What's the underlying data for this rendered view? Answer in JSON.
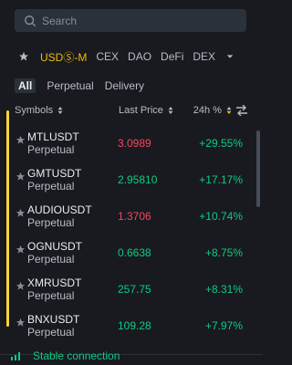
{
  "search": {
    "placeholder": "Search"
  },
  "categories": {
    "items": [
      "USDⓈ-M",
      "CEX",
      "DAO",
      "DeFi",
      "DEX"
    ],
    "active_index": 0
  },
  "subtabs": [
    "All",
    "Perpetual",
    "Delivery"
  ],
  "columns": {
    "symbol": "Symbols",
    "price": "Last Price",
    "change": "24h %"
  },
  "rows": [
    {
      "symbol": "MTLUSDT",
      "type": "Perpetual",
      "price": "3.0989",
      "change": "+29.55%",
      "price_dir": "down"
    },
    {
      "symbol": "GMTUSDT",
      "type": "Perpetual",
      "price": "2.95810",
      "change": "+17.17%",
      "price_dir": "up"
    },
    {
      "symbol": "AUDIOUSDT",
      "type": "Perpetual",
      "price": "1.3706",
      "change": "+10.74%",
      "price_dir": "down"
    },
    {
      "symbol": "OGNUSDT",
      "type": "Perpetual",
      "price": "0.6638",
      "change": "+8.75%",
      "price_dir": "up"
    },
    {
      "symbol": "XMRUSDT",
      "type": "Perpetual",
      "price": "257.75",
      "change": "+8.31%",
      "price_dir": "up"
    },
    {
      "symbol": "BNXUSDT",
      "type": "Perpetual",
      "price": "109.28",
      "change": "+7.97%",
      "price_dir": "up"
    }
  ],
  "footer": {
    "status": "Stable connection"
  },
  "colors": {
    "up": "#0ecb81",
    "down": "#f6465d",
    "accent": "#f0b90b"
  }
}
